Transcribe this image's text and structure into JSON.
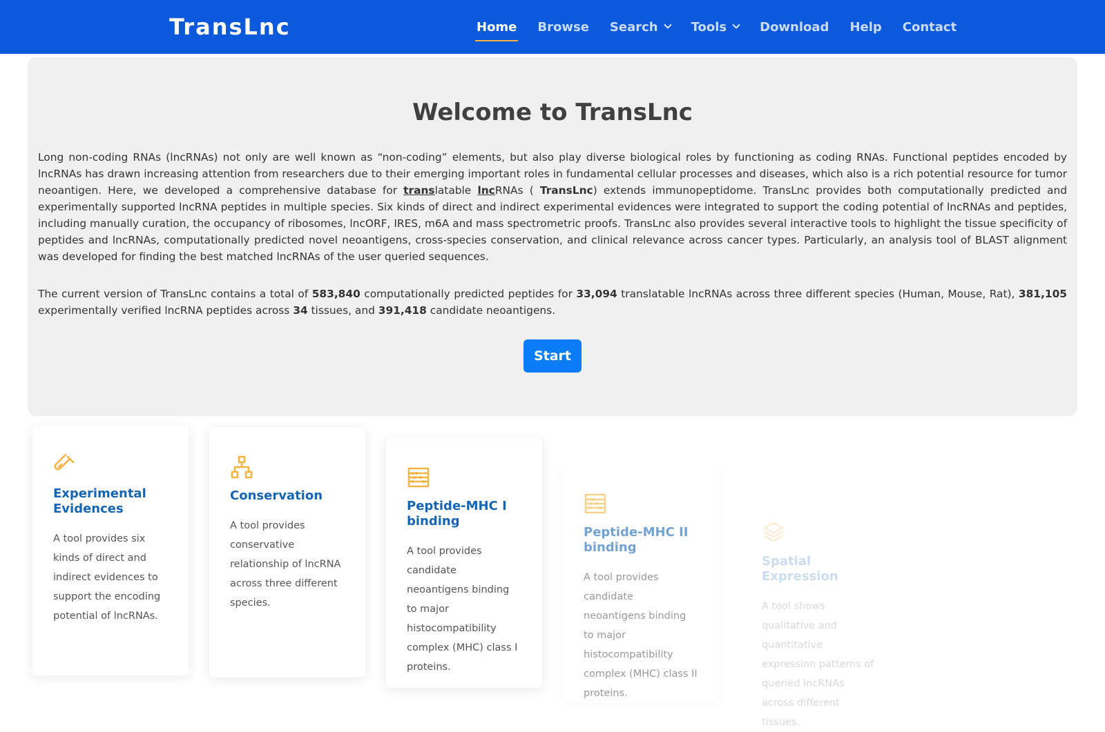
{
  "navbar": {
    "brand": "TransLnc",
    "items": [
      {
        "label": "Home",
        "active": true
      },
      {
        "label": "Browse"
      },
      {
        "label": "Search",
        "dropdown": true
      },
      {
        "label": "Tools",
        "dropdown": true
      },
      {
        "label": "Download"
      },
      {
        "label": "Help"
      },
      {
        "label": "Contact"
      }
    ]
  },
  "jumbotron": {
    "title": "Welcome to TransLnc",
    "intro": {
      "p1": "Long non-coding RNAs (lncRNAs) not only are well known as “non-coding” elements, but also play diverse biological roles by functioning as coding RNAs. Functional peptides encoded by lncRNAs has drawn increasing attention from researchers due to their emerging important roles in fundamental cellular processes and diseases, which also is a rich potential resource for tumor neoantigen. Here, we developed a comprehensive database for ",
      "trans": "trans",
      "latable": "latable ",
      "lnc": "lnc",
      "rnas_open": "RNAs ( ",
      "translnc": "TransLnc",
      "p2": ") extends immunopeptidome. TransLnc provides both computationally predicted and experimentally supported lncRNA peptides in multiple species. Six kinds of direct and indirect experimental evidences were integrated to support the coding potential of lncRNAs and peptides, including manually curation, the occupancy of ribosomes, lncORF, IRES, m6A and mass spectrometric proofs. TransLnc also provides several interactive tools to highlight the tissue specificity of peptides and lncRNAs, computationally predicted novel neoantigens, cross-species conservation, and clinical relevance across cancer types. Particularly, an analysis tool of BLAST alignment was developed for finding the best matched lncRNAs of the user queried sequences."
    },
    "stats": {
      "t1": "The current version of TransLnc contains a total of ",
      "predicted_peptides": "583,840",
      "t2": " computationally predicted peptides for ",
      "translatable_lncrnas": "33,094",
      "t3": " translatable lncRNAs across three different species (Human, Mouse, Rat), ",
      "verified_peptides": "381,105",
      "t4": " experimentally verified lncRNA peptides across ",
      "tissues": "34",
      "t5": " tissues, and ",
      "neoantigens": "391,418",
      "t6": " candidate neoantigens."
    },
    "start_label": "Start"
  },
  "cards": [
    {
      "icon": "test-tube-icon",
      "title": "Experimental Evidences",
      "text": "A tool provides six kinds of direct and indirect evidences to support the encoding potential of lncRNAs."
    },
    {
      "icon": "hierarchy-icon",
      "title": "Conservation",
      "text": "A tool provides conservative relationship of lncRNA across three different species."
    },
    {
      "icon": "abacus-icon",
      "title": "Peptide-MHC I binding",
      "text": "A tool provides candidate neoantigens binding to major histocompatibility complex (MHC) class I proteins."
    },
    {
      "icon": "abacus-icon",
      "title": "Peptide-MHC II binding",
      "text": "A tool provides candidate neoantigens binding to major histocompatibility complex (MHC) class II proteins."
    },
    {
      "icon": "layers-icon",
      "title": "Spatial Expression",
      "text": "A tool shows qualitative and quantitative expression patterns of queried lncRNAs across different tissues."
    }
  ],
  "colors": {
    "navbar_bg": "#0c5adb",
    "accent_underline": "#f5b342",
    "button_bg": "#0a7cf5",
    "card_title": "#1565b5",
    "icon": "#f5b342"
  }
}
